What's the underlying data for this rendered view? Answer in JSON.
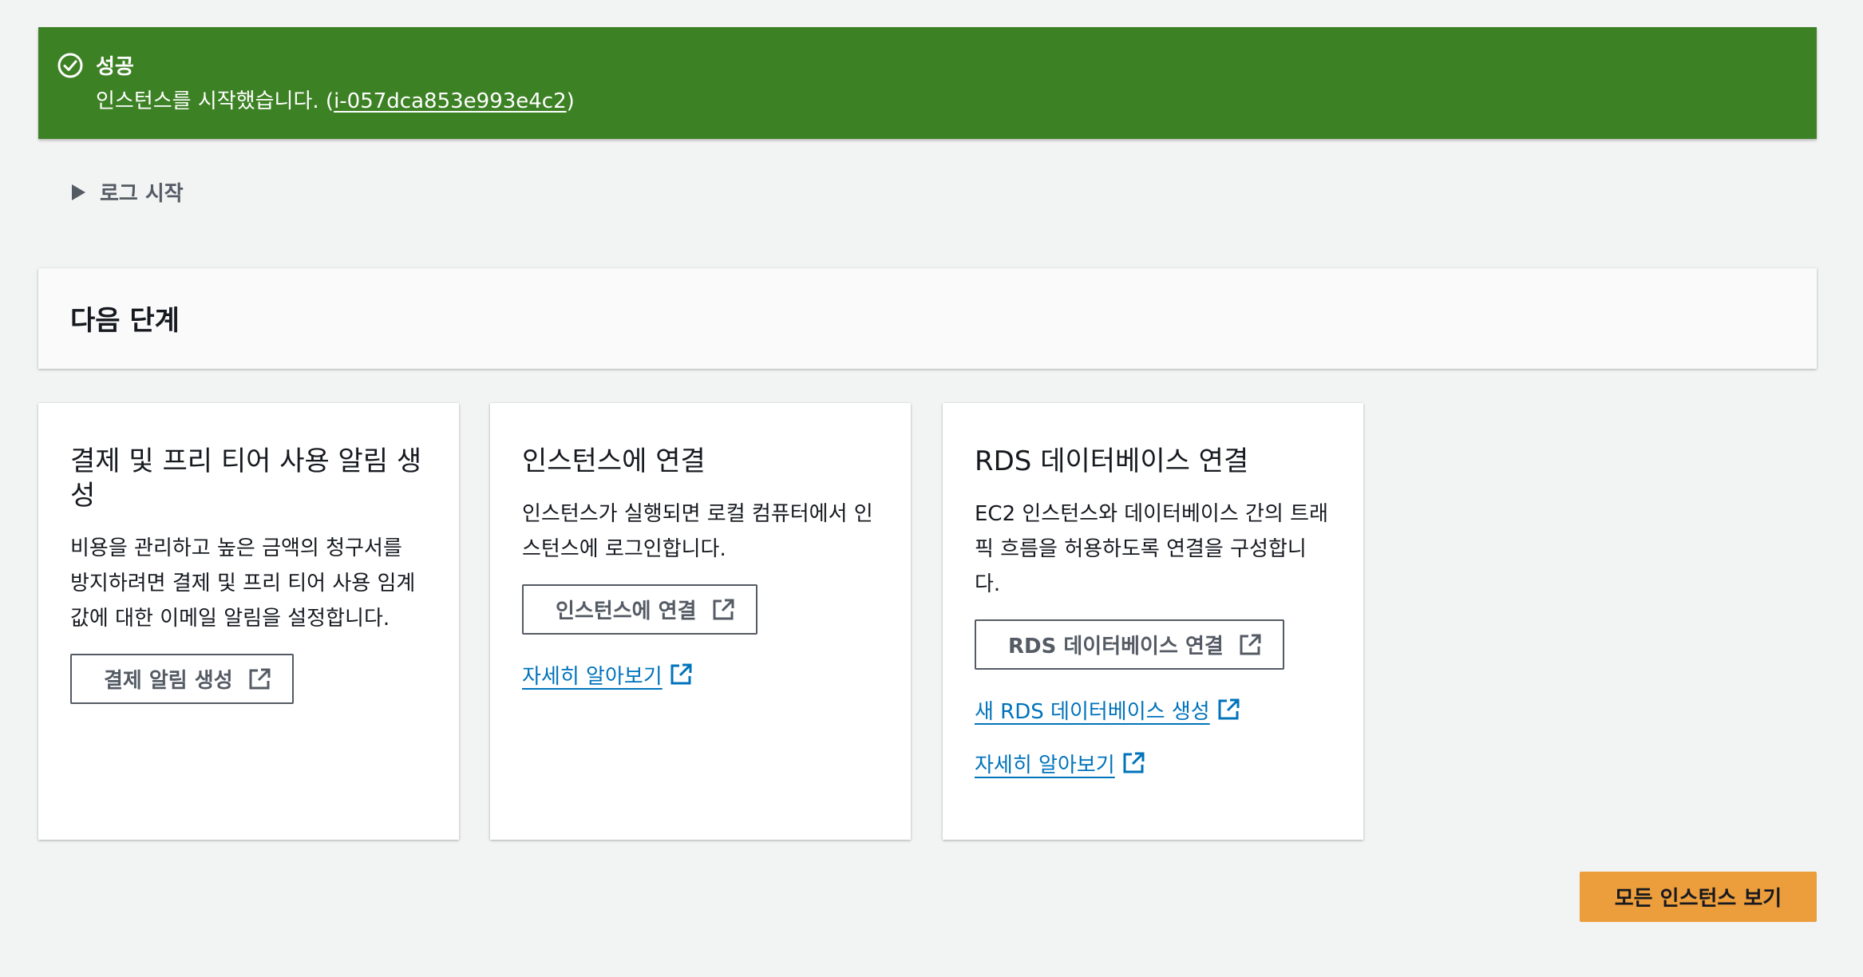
{
  "flash": {
    "title": "성공",
    "message_prefix": "인스턴스를 시작했습니다. (",
    "instance_id": "i-057dca853e993e4c2",
    "message_suffix": ")",
    "color": "#3d8125"
  },
  "log": {
    "label": "로그 시작"
  },
  "next_steps": {
    "title": "다음 단계"
  },
  "cards": [
    {
      "title": "결제 및 프리 티어 사용 알림 생성",
      "description": "비용을 관리하고 높은 금액의 청구서를 방지하려면 결제 및 프리 티어 사용 임계값에 대한 이메일 알림을 설정합니다.",
      "button": "결제 알림 생성"
    },
    {
      "title": "인스턴스에 연결",
      "description": "인스턴스가 실행되면 로컬 컴퓨터에서 인스턴스에 로그인합니다.",
      "button": "인스턴스에 연결",
      "links": [
        "자세히 알아보기"
      ]
    },
    {
      "title": "RDS 데이터베이스 연결",
      "description": "EC2 인스턴스와 데이터베이스 간의 트래픽 흐름을 허용하도록 연결을 구성합니다.",
      "button": "RDS 데이터베이스 연결",
      "links": [
        "새 RDS 데이터베이스 생성",
        "자세히 알아보기"
      ]
    }
  ],
  "primary_button": {
    "label": "모든 인스턴스 보기",
    "color": "#ec9d3c"
  },
  "colors": {
    "link": "#0073bb",
    "background": "#f2f3f3"
  }
}
